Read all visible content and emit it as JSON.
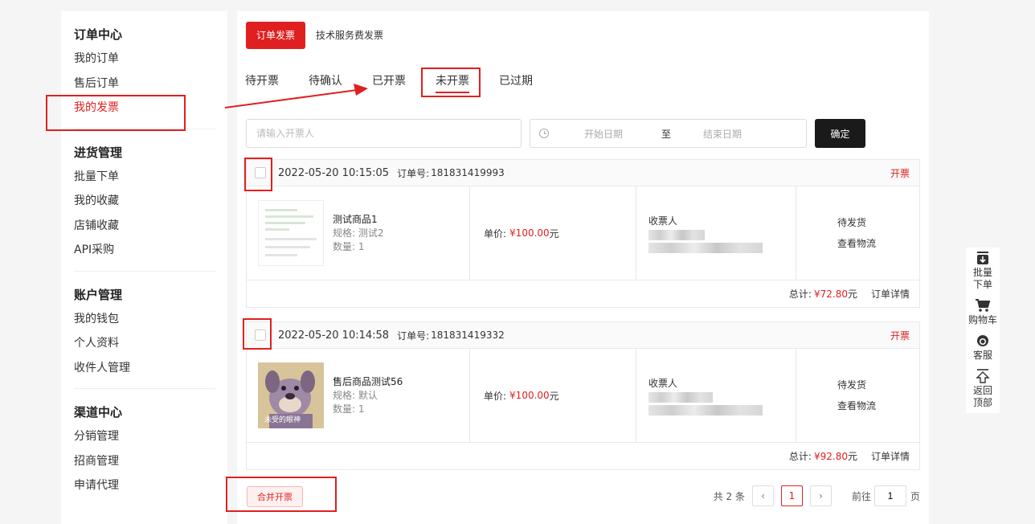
{
  "sidebar": {
    "groups": [
      {
        "title": "订单中心",
        "items": [
          "我的订单",
          "售后订单",
          "我的发票"
        ]
      },
      {
        "title": "进货管理",
        "items": [
          "批量下单",
          "我的收藏",
          "店铺收藏",
          "API采购"
        ]
      },
      {
        "title": "账户管理",
        "items": [
          "我的钱包",
          "个人资料",
          "收件人管理"
        ]
      },
      {
        "title": "渠道中心",
        "items": [
          "分销管理",
          "招商管理",
          "申请代理"
        ]
      }
    ]
  },
  "top_tabs": [
    "订单发票",
    "技术服务费发票"
  ],
  "status_tabs": [
    "待开票",
    "待确认",
    "已开票",
    "未开票",
    "已过期"
  ],
  "filter": {
    "search_placeholder": "请输入开票人",
    "start_date": "开始日期",
    "separator": "至",
    "end_date": "结束日期",
    "confirm": "确定"
  },
  "orders": [
    {
      "time": "2022-05-20 10:15:05",
      "order_no_label": "订单号:",
      "order_no": "181831419993",
      "invoice": "开票",
      "product_name": "测试商品1",
      "spec": "规格: 测试2",
      "qty": "数量: 1",
      "price_label": "单价:",
      "price": "¥100.00",
      "price_unit": "元",
      "receiver_label": "收票人",
      "status": "待发货",
      "logistics": "查看物流",
      "total_label": "总计:",
      "total": "¥72.80",
      "total_unit": "元",
      "detail": "订单详情"
    },
    {
      "time": "2022-05-20 10:14:58",
      "order_no_label": "订单号:",
      "order_no": "181831419332",
      "invoice": "开票",
      "product_name": "售后商品测试56",
      "spec": "规格: 默认",
      "qty": "数量: 1",
      "price_label": "单价:",
      "price": "¥100.00",
      "price_unit": "元",
      "receiver_label": "收票人",
      "status": "待发货",
      "logistics": "查看物流",
      "total_label": "总计:",
      "total": "¥92.80",
      "total_unit": "元",
      "detail": "订单详情",
      "thumb_caption": "未受的眼神"
    }
  ],
  "bottom": {
    "merge": "合并开票",
    "total_count": "共 2 条",
    "current_page": "1",
    "goto_label": "前往",
    "goto_value": "1",
    "page_suffix": "页"
  },
  "float_bar": {
    "bulk_order": "批量下单",
    "cart": "购物车",
    "service": "客服",
    "back_top": "返回顶部"
  },
  "colors": {
    "accent": "#e02020",
    "dark_button": "#1a1a1a",
    "annotation": "#e0201f"
  }
}
